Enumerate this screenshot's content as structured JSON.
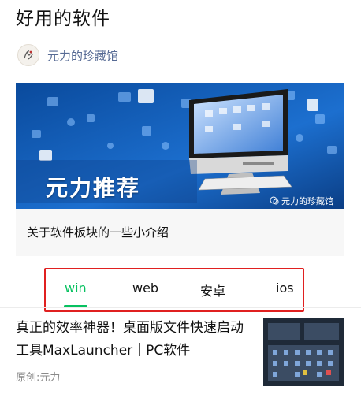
{
  "page": {
    "title": "好用的软件"
  },
  "account": {
    "name": "元力的珍藏馆"
  },
  "banner": {
    "title": "元力推荐",
    "watermark": "元力的珍藏馆",
    "caption": "关于软件板块的一些小介绍"
  },
  "tabs": [
    {
      "label": "win",
      "active": true
    },
    {
      "label": "web",
      "active": false
    },
    {
      "label": "安卓",
      "active": false
    },
    {
      "label": "ios",
      "active": false
    }
  ],
  "article": {
    "title": "真正的效率神器！桌面版文件快速启动工具MaxLauncher｜PC软件",
    "meta": "原创:元力"
  },
  "colors": {
    "accent": "#07c160",
    "highlight_border": "#e02020",
    "link": "#576b95"
  }
}
